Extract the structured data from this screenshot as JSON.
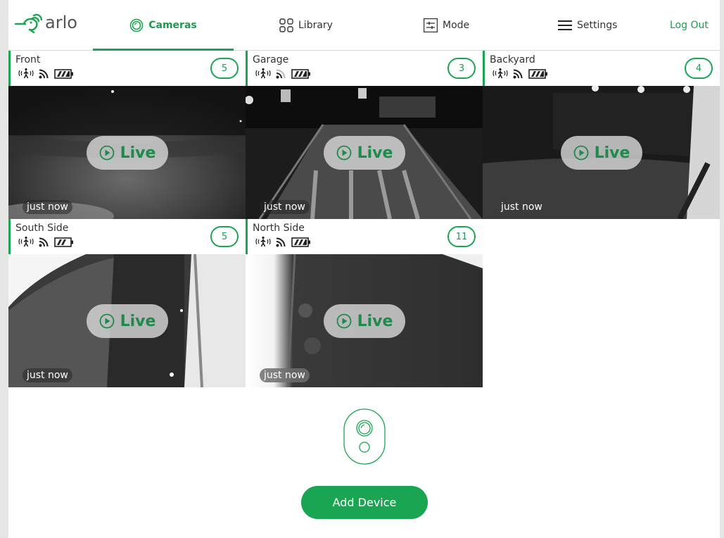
{
  "app": {
    "brand": "arlo",
    "accent_color": "#1aa552"
  },
  "nav": {
    "cameras": "Cameras",
    "library": "Library",
    "mode": "Mode",
    "settings": "Settings",
    "logout": "Log Out",
    "active": "cameras"
  },
  "cameras": [
    {
      "name": "Front",
      "count": "5",
      "timestamp": "just now",
      "live_label": "Live",
      "signal": "full",
      "battery": "full",
      "motion": "motion-icon"
    },
    {
      "name": "Garage",
      "count": "3",
      "timestamp": "just now",
      "live_label": "Live",
      "signal": "weak",
      "battery": "full",
      "motion": "motion-icon"
    },
    {
      "name": "Backyard",
      "count": "4",
      "timestamp": "just now",
      "live_label": "Live",
      "signal": "full",
      "battery": "full",
      "motion": "motion-icon"
    },
    {
      "name": "South Side",
      "count": "5",
      "timestamp": "just now",
      "live_label": "Live",
      "signal": "full",
      "battery": "medium",
      "motion": "motion-icon"
    },
    {
      "name": "North Side",
      "count": "11",
      "timestamp": "just now",
      "live_label": "Live",
      "signal": "full",
      "battery": "full",
      "motion": "motion-icon"
    }
  ],
  "add_device": {
    "label": "Add Device",
    "icon": "camera-device-icon"
  }
}
